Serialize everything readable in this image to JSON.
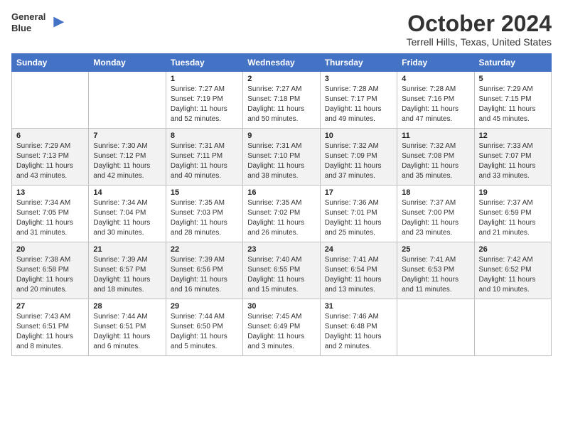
{
  "header": {
    "logo_line1": "General",
    "logo_line2": "Blue",
    "title": "October 2024",
    "subtitle": "Terrell Hills, Texas, United States"
  },
  "days_of_week": [
    "Sunday",
    "Monday",
    "Tuesday",
    "Wednesday",
    "Thursday",
    "Friday",
    "Saturday"
  ],
  "weeks": [
    [
      {
        "num": "",
        "sunrise": "",
        "sunset": "",
        "daylight": ""
      },
      {
        "num": "",
        "sunrise": "",
        "sunset": "",
        "daylight": ""
      },
      {
        "num": "1",
        "sunrise": "Sunrise: 7:27 AM",
        "sunset": "Sunset: 7:19 PM",
        "daylight": "Daylight: 11 hours and 52 minutes."
      },
      {
        "num": "2",
        "sunrise": "Sunrise: 7:27 AM",
        "sunset": "Sunset: 7:18 PM",
        "daylight": "Daylight: 11 hours and 50 minutes."
      },
      {
        "num": "3",
        "sunrise": "Sunrise: 7:28 AM",
        "sunset": "Sunset: 7:17 PM",
        "daylight": "Daylight: 11 hours and 49 minutes."
      },
      {
        "num": "4",
        "sunrise": "Sunrise: 7:28 AM",
        "sunset": "Sunset: 7:16 PM",
        "daylight": "Daylight: 11 hours and 47 minutes."
      },
      {
        "num": "5",
        "sunrise": "Sunrise: 7:29 AM",
        "sunset": "Sunset: 7:15 PM",
        "daylight": "Daylight: 11 hours and 45 minutes."
      }
    ],
    [
      {
        "num": "6",
        "sunrise": "Sunrise: 7:29 AM",
        "sunset": "Sunset: 7:13 PM",
        "daylight": "Daylight: 11 hours and 43 minutes."
      },
      {
        "num": "7",
        "sunrise": "Sunrise: 7:30 AM",
        "sunset": "Sunset: 7:12 PM",
        "daylight": "Daylight: 11 hours and 42 minutes."
      },
      {
        "num": "8",
        "sunrise": "Sunrise: 7:31 AM",
        "sunset": "Sunset: 7:11 PM",
        "daylight": "Daylight: 11 hours and 40 minutes."
      },
      {
        "num": "9",
        "sunrise": "Sunrise: 7:31 AM",
        "sunset": "Sunset: 7:10 PM",
        "daylight": "Daylight: 11 hours and 38 minutes."
      },
      {
        "num": "10",
        "sunrise": "Sunrise: 7:32 AM",
        "sunset": "Sunset: 7:09 PM",
        "daylight": "Daylight: 11 hours and 37 minutes."
      },
      {
        "num": "11",
        "sunrise": "Sunrise: 7:32 AM",
        "sunset": "Sunset: 7:08 PM",
        "daylight": "Daylight: 11 hours and 35 minutes."
      },
      {
        "num": "12",
        "sunrise": "Sunrise: 7:33 AM",
        "sunset": "Sunset: 7:07 PM",
        "daylight": "Daylight: 11 hours and 33 minutes."
      }
    ],
    [
      {
        "num": "13",
        "sunrise": "Sunrise: 7:34 AM",
        "sunset": "Sunset: 7:05 PM",
        "daylight": "Daylight: 11 hours and 31 minutes."
      },
      {
        "num": "14",
        "sunrise": "Sunrise: 7:34 AM",
        "sunset": "Sunset: 7:04 PM",
        "daylight": "Daylight: 11 hours and 30 minutes."
      },
      {
        "num": "15",
        "sunrise": "Sunrise: 7:35 AM",
        "sunset": "Sunset: 7:03 PM",
        "daylight": "Daylight: 11 hours and 28 minutes."
      },
      {
        "num": "16",
        "sunrise": "Sunrise: 7:35 AM",
        "sunset": "Sunset: 7:02 PM",
        "daylight": "Daylight: 11 hours and 26 minutes."
      },
      {
        "num": "17",
        "sunrise": "Sunrise: 7:36 AM",
        "sunset": "Sunset: 7:01 PM",
        "daylight": "Daylight: 11 hours and 25 minutes."
      },
      {
        "num": "18",
        "sunrise": "Sunrise: 7:37 AM",
        "sunset": "Sunset: 7:00 PM",
        "daylight": "Daylight: 11 hours and 23 minutes."
      },
      {
        "num": "19",
        "sunrise": "Sunrise: 7:37 AM",
        "sunset": "Sunset: 6:59 PM",
        "daylight": "Daylight: 11 hours and 21 minutes."
      }
    ],
    [
      {
        "num": "20",
        "sunrise": "Sunrise: 7:38 AM",
        "sunset": "Sunset: 6:58 PM",
        "daylight": "Daylight: 11 hours and 20 minutes."
      },
      {
        "num": "21",
        "sunrise": "Sunrise: 7:39 AM",
        "sunset": "Sunset: 6:57 PM",
        "daylight": "Daylight: 11 hours and 18 minutes."
      },
      {
        "num": "22",
        "sunrise": "Sunrise: 7:39 AM",
        "sunset": "Sunset: 6:56 PM",
        "daylight": "Daylight: 11 hours and 16 minutes."
      },
      {
        "num": "23",
        "sunrise": "Sunrise: 7:40 AM",
        "sunset": "Sunset: 6:55 PM",
        "daylight": "Daylight: 11 hours and 15 minutes."
      },
      {
        "num": "24",
        "sunrise": "Sunrise: 7:41 AM",
        "sunset": "Sunset: 6:54 PM",
        "daylight": "Daylight: 11 hours and 13 minutes."
      },
      {
        "num": "25",
        "sunrise": "Sunrise: 7:41 AM",
        "sunset": "Sunset: 6:53 PM",
        "daylight": "Daylight: 11 hours and 11 minutes."
      },
      {
        "num": "26",
        "sunrise": "Sunrise: 7:42 AM",
        "sunset": "Sunset: 6:52 PM",
        "daylight": "Daylight: 11 hours and 10 minutes."
      }
    ],
    [
      {
        "num": "27",
        "sunrise": "Sunrise: 7:43 AM",
        "sunset": "Sunset: 6:51 PM",
        "daylight": "Daylight: 11 hours and 8 minutes."
      },
      {
        "num": "28",
        "sunrise": "Sunrise: 7:44 AM",
        "sunset": "Sunset: 6:51 PM",
        "daylight": "Daylight: 11 hours and 6 minutes."
      },
      {
        "num": "29",
        "sunrise": "Sunrise: 7:44 AM",
        "sunset": "Sunset: 6:50 PM",
        "daylight": "Daylight: 11 hours and 5 minutes."
      },
      {
        "num": "30",
        "sunrise": "Sunrise: 7:45 AM",
        "sunset": "Sunset: 6:49 PM",
        "daylight": "Daylight: 11 hours and 3 minutes."
      },
      {
        "num": "31",
        "sunrise": "Sunrise: 7:46 AM",
        "sunset": "Sunset: 6:48 PM",
        "daylight": "Daylight: 11 hours and 2 minutes."
      },
      {
        "num": "",
        "sunrise": "",
        "sunset": "",
        "daylight": ""
      },
      {
        "num": "",
        "sunrise": "",
        "sunset": "",
        "daylight": ""
      }
    ]
  ]
}
